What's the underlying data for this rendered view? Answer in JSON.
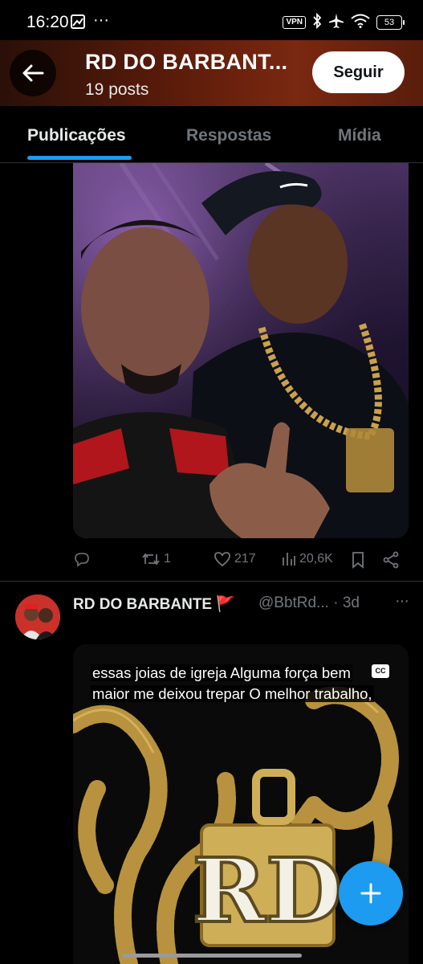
{
  "status_bar": {
    "time": "16:20",
    "dots": "···",
    "vpn": "VPN",
    "battery": "53",
    "icons": [
      "photo-notification-icon",
      "vpn-icon",
      "bluetooth-icon",
      "airplane-icon",
      "wifi-icon",
      "battery-icon"
    ]
  },
  "header": {
    "title": "RD DO BARBANT...",
    "posts": "19 posts",
    "follow_label": "Seguir"
  },
  "tabs": [
    {
      "label": "Publicações",
      "active": true
    },
    {
      "label": "Respostas",
      "active": false
    },
    {
      "label": "Mídia",
      "active": false
    }
  ],
  "post1": {
    "photo_alt": "two men posing, one with a gold chain and RD pendant",
    "reposts": "1",
    "likes": "217",
    "views": "20,6K"
  },
  "post2": {
    "name": "RD DO BARBANTE",
    "flag": "🚩",
    "handle": "@BbtRd...",
    "time": "· 3d",
    "more": "···",
    "caption": "essas joias de igreja Alguma força bem maior me deixou trepar O melhor trabalho,",
    "cc": "CC",
    "pendant_text": "RD"
  },
  "colors": {
    "accent": "#1d9bf0",
    "muted": "#71767b",
    "text": "#e7e9ea",
    "background": "#000000",
    "header_bg": "#5a1b0a",
    "gold": "#c9a24a"
  }
}
